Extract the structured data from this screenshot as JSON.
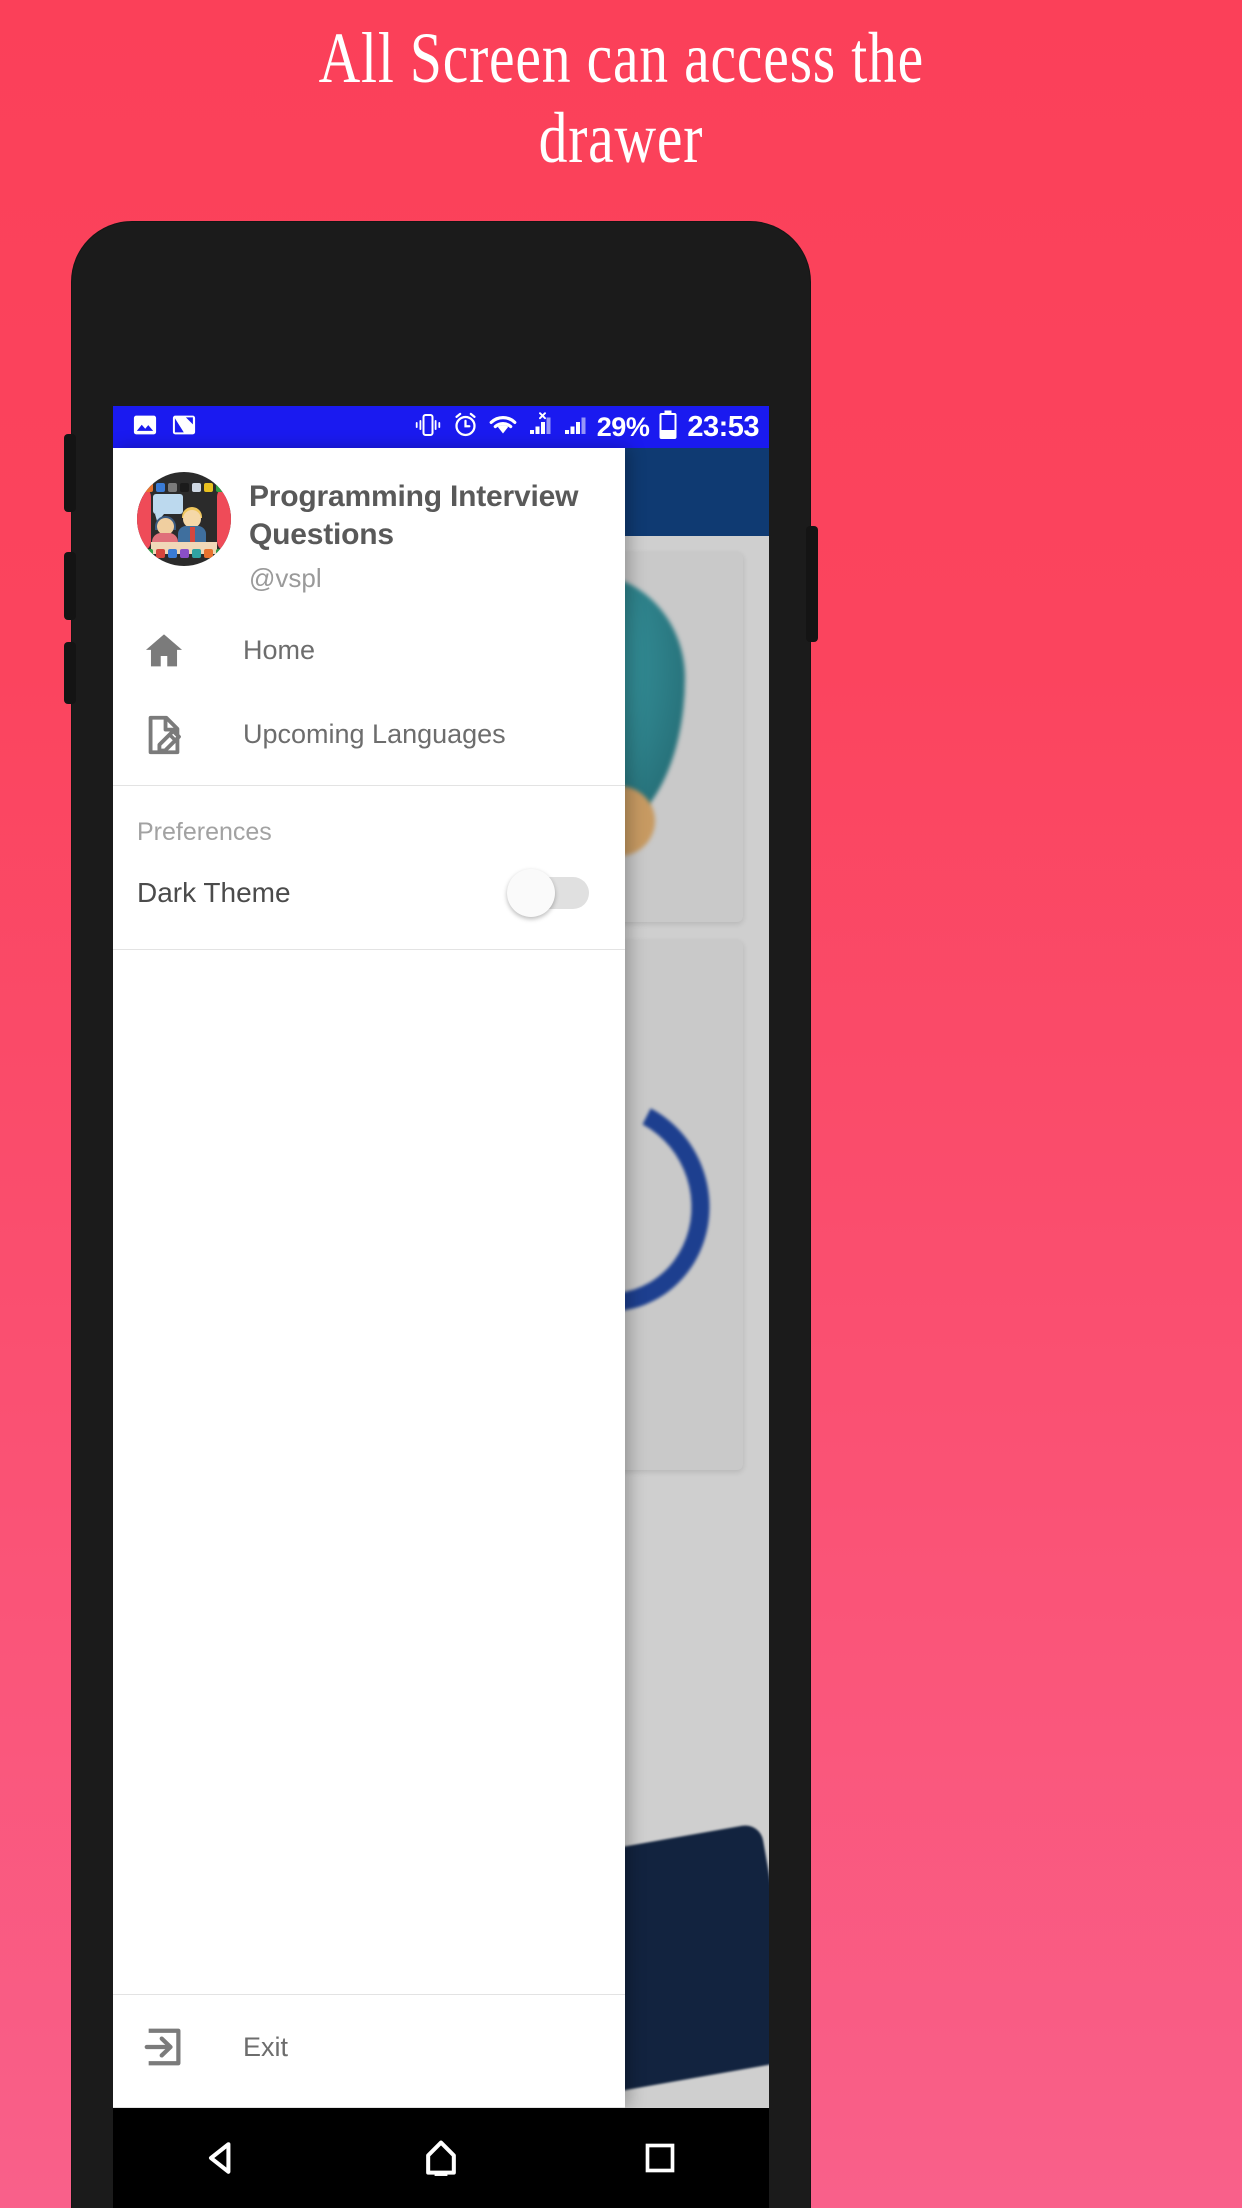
{
  "promo": {
    "headline_line1": "All Screen can access the",
    "headline_line2": "drawer",
    "bg_color_top": "#fb4059",
    "bg_color_bottom": "#f9608a"
  },
  "status_bar": {
    "background": "#1a1af0",
    "left_icons": [
      "image-icon",
      "screenshot-icon"
    ],
    "right_icons": [
      "vibrate-icon",
      "alarm-icon",
      "wifi-icon",
      "no-sim-signal-icon",
      "signal-bars-icon"
    ],
    "battery_percent": "29%",
    "battery_icon": "battery-icon",
    "clock": "23:53"
  },
  "drawer": {
    "avatar_name": "app-logo-avatar",
    "app_title": "Programming Interview Questions",
    "app_handle": "@vspl",
    "items": [
      {
        "label": "Home",
        "icon": "home-icon"
      },
      {
        "label": "Upcoming Languages",
        "icon": "edit-document-icon"
      }
    ],
    "section_title": "Preferences",
    "dark_theme": {
      "label": "Dark Theme",
      "state": "off"
    },
    "exit": {
      "label": "Exit",
      "icon": "exit-icon"
    }
  },
  "behind": {
    "appbar_color": "#0f3a72"
  },
  "navigation_bar": {
    "back": "back-triangle-icon",
    "home": "home-pentagon-icon",
    "recents": "recents-square-icon"
  }
}
